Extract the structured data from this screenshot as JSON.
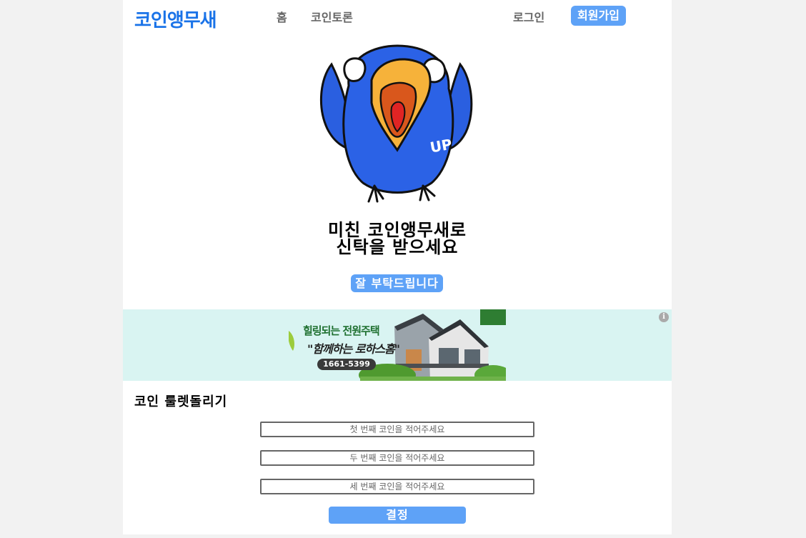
{
  "header": {
    "logo": "코인앵무새",
    "nav": {
      "home": "홈",
      "board": "코인토론",
      "login": "로그인",
      "signup": "회원가입"
    }
  },
  "hero": {
    "parrot_badge": "UP",
    "title_line1": "미친 코인앵무새로",
    "title_line2": "신탁을 받으세요",
    "button": "잘 부탁드립니다"
  },
  "ad": {
    "headline": "힐링되는 전원주택",
    "slogan": "\"함께하는 로하스홈\"",
    "phone": "1661-5399",
    "info_icon": "i"
  },
  "roulette": {
    "title": "코인 룰렛돌리기",
    "inputs": [
      {
        "value": "",
        "placeholder": "첫 번째 코인을 적어주세요"
      },
      {
        "value": "",
        "placeholder": "두 번째 코인을 적어주세요"
      },
      {
        "value": "",
        "placeholder": "세 번째 코인을 적어주세요"
      }
    ],
    "submit": "결정"
  },
  "colors": {
    "brand": "#1a73e8",
    "accent_button": "#5ea2f7",
    "ad_background": "#d9f4f2",
    "page_background": "#f2f2f2"
  },
  "icons": {
    "hero_image": "parrot-mascot-icon",
    "ad_info": "info-icon"
  }
}
